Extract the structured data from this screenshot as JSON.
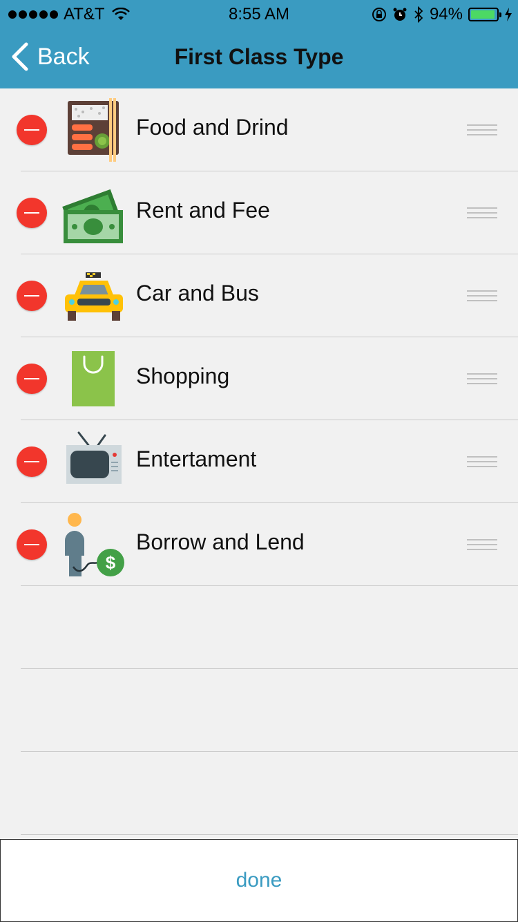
{
  "status_bar": {
    "carrier": "AT&T",
    "time": "8:55 AM",
    "battery_percent": "94%"
  },
  "nav": {
    "back_label": "Back",
    "title": "First Class Type"
  },
  "categories": [
    {
      "label": "Food and Drind",
      "icon": "bento-box-icon"
    },
    {
      "label": "Rent and Fee",
      "icon": "money-bills-icon"
    },
    {
      "label": "Car and Bus",
      "icon": "taxi-icon"
    },
    {
      "label": "Shopping",
      "icon": "shopping-bag-icon"
    },
    {
      "label": "Entertament",
      "icon": "tv-icon"
    },
    {
      "label": "Borrow and Lend",
      "icon": "person-dollar-icon"
    }
  ],
  "footer": {
    "done_label": "done"
  },
  "colors": {
    "header": "#3a9bc1",
    "delete": "#f2362c",
    "done_text": "#3a9bc1"
  }
}
